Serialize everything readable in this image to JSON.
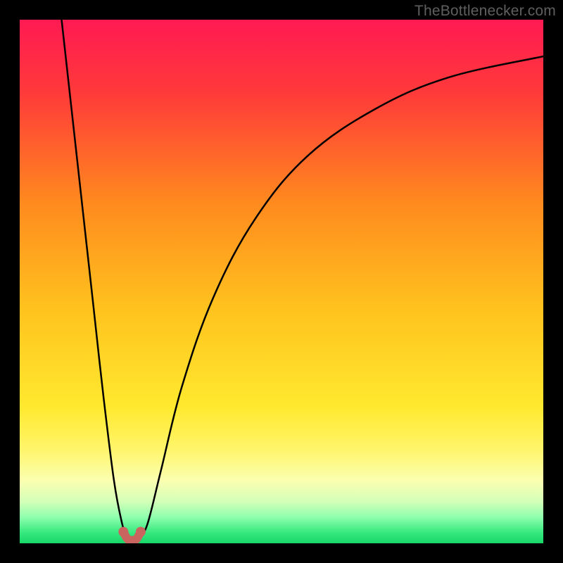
{
  "watermark": "TheBottlenecker.com",
  "gradient": {
    "stops": [
      {
        "pct": 0,
        "color": "#ff1a52"
      },
      {
        "pct": 14,
        "color": "#ff3a3a"
      },
      {
        "pct": 35,
        "color": "#ff8a1e"
      },
      {
        "pct": 55,
        "color": "#ffc21e"
      },
      {
        "pct": 74,
        "color": "#ffe92e"
      },
      {
        "pct": 82,
        "color": "#fff56a"
      },
      {
        "pct": 88,
        "color": "#fbffb0"
      },
      {
        "pct": 92,
        "color": "#d4ffb8"
      },
      {
        "pct": 95,
        "color": "#8fffae"
      },
      {
        "pct": 98,
        "color": "#36e97e"
      },
      {
        "pct": 100,
        "color": "#18d668"
      }
    ]
  },
  "chart_data": {
    "type": "line",
    "title": "",
    "xlabel": "",
    "ylabel": "",
    "xlim": [
      0,
      100
    ],
    "ylim": [
      0,
      100
    ],
    "annotations": [],
    "series": [
      {
        "name": "left-branch",
        "x": [
          8,
          10,
          12,
          14,
          16,
          18,
          19.5,
          20.5
        ],
        "y": [
          100,
          82,
          64,
          46,
          28,
          12,
          4,
          1
        ]
      },
      {
        "name": "right-branch",
        "x": [
          23,
          24.5,
          27,
          31,
          37,
          45,
          55,
          68,
          82,
          100
        ],
        "y": [
          1,
          4,
          14,
          30,
          47,
          62,
          74,
          83,
          89,
          93
        ]
      },
      {
        "name": "valley-marker",
        "x": [
          19.8,
          20.6,
          21.5,
          22.3,
          23.1
        ],
        "y": [
          2.2,
          0.8,
          0.6,
          0.8,
          2.2
        ]
      }
    ],
    "valley_x": 21.5,
    "valley_marker_color": "#c9645e"
  }
}
